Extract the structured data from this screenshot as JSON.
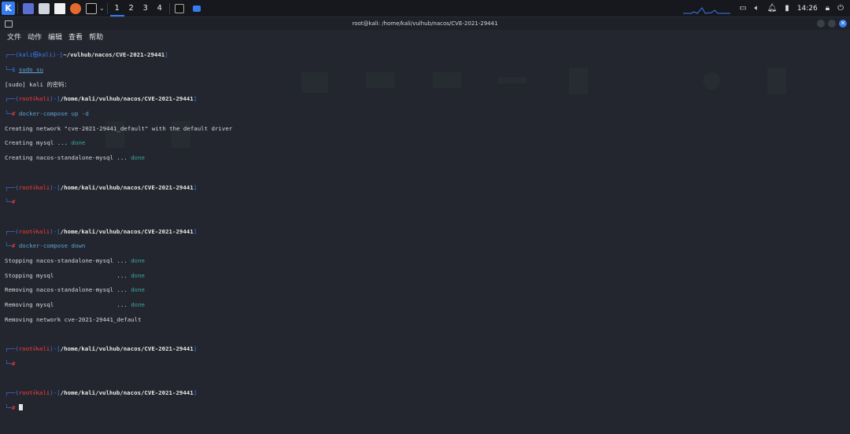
{
  "panel": {
    "workspaces": [
      "1",
      "2",
      "3",
      "4"
    ],
    "active_workspace": 0,
    "clock": "14:26",
    "icons": [
      "kali-menu-icon",
      "desktop-icon",
      "file-manager-icon",
      "text-editor-icon",
      "firefox-icon",
      "terminal-icon",
      "chevron-down-icon",
      "terminal-window-icon",
      "folder-window-icon",
      "monitor-icon",
      "volume-icon",
      "bell-icon",
      "battery-icon",
      "lock-icon",
      "logout-icon"
    ]
  },
  "window": {
    "title": "root@kali: /home/kali/vulhub/nacos/CVE-2021-29441",
    "menu": [
      "文件",
      "动作",
      "编辑",
      "查看",
      "帮助"
    ]
  },
  "terminal": {
    "p1_user": "kali",
    "p1_host": "kali",
    "p1_dir": "~/vulhub/nacos/CVE-2021-29441",
    "cmd1": "sudo su",
    "sudo_prompt": "[sudo] kali 的密码：",
    "root_user": "root",
    "root_host": "kali",
    "root_dir": "/home/kali/vulhub/nacos/CVE-2021-29441",
    "cmd2": "docker-compose up -d",
    "out2": [
      {
        "text": "Creating network \"cve-2021-29441_default\" with the default driver",
        "status": ""
      },
      {
        "text": "Creating mysql ... ",
        "status": "done"
      },
      {
        "text": "Creating nacos-standalone-mysql ... ",
        "status": "done"
      }
    ],
    "cmd3": "docker-compose down",
    "out3": [
      {
        "text": "Stopping nacos-standalone-mysql ... ",
        "status": "done"
      },
      {
        "text": "Stopping mysql                  ... ",
        "status": "done"
      },
      {
        "text": "Removing nacos-standalone-mysql ... ",
        "status": "done"
      },
      {
        "text": "Removing mysql                  ... ",
        "status": "done"
      },
      {
        "text": "Removing network cve-2021-29441_default",
        "status": ""
      }
    ]
  },
  "colors": {
    "accent": "#367bf0",
    "prompt_red": "#ff3b3b",
    "done": "#3aa8a0",
    "background": "#23262e"
  }
}
